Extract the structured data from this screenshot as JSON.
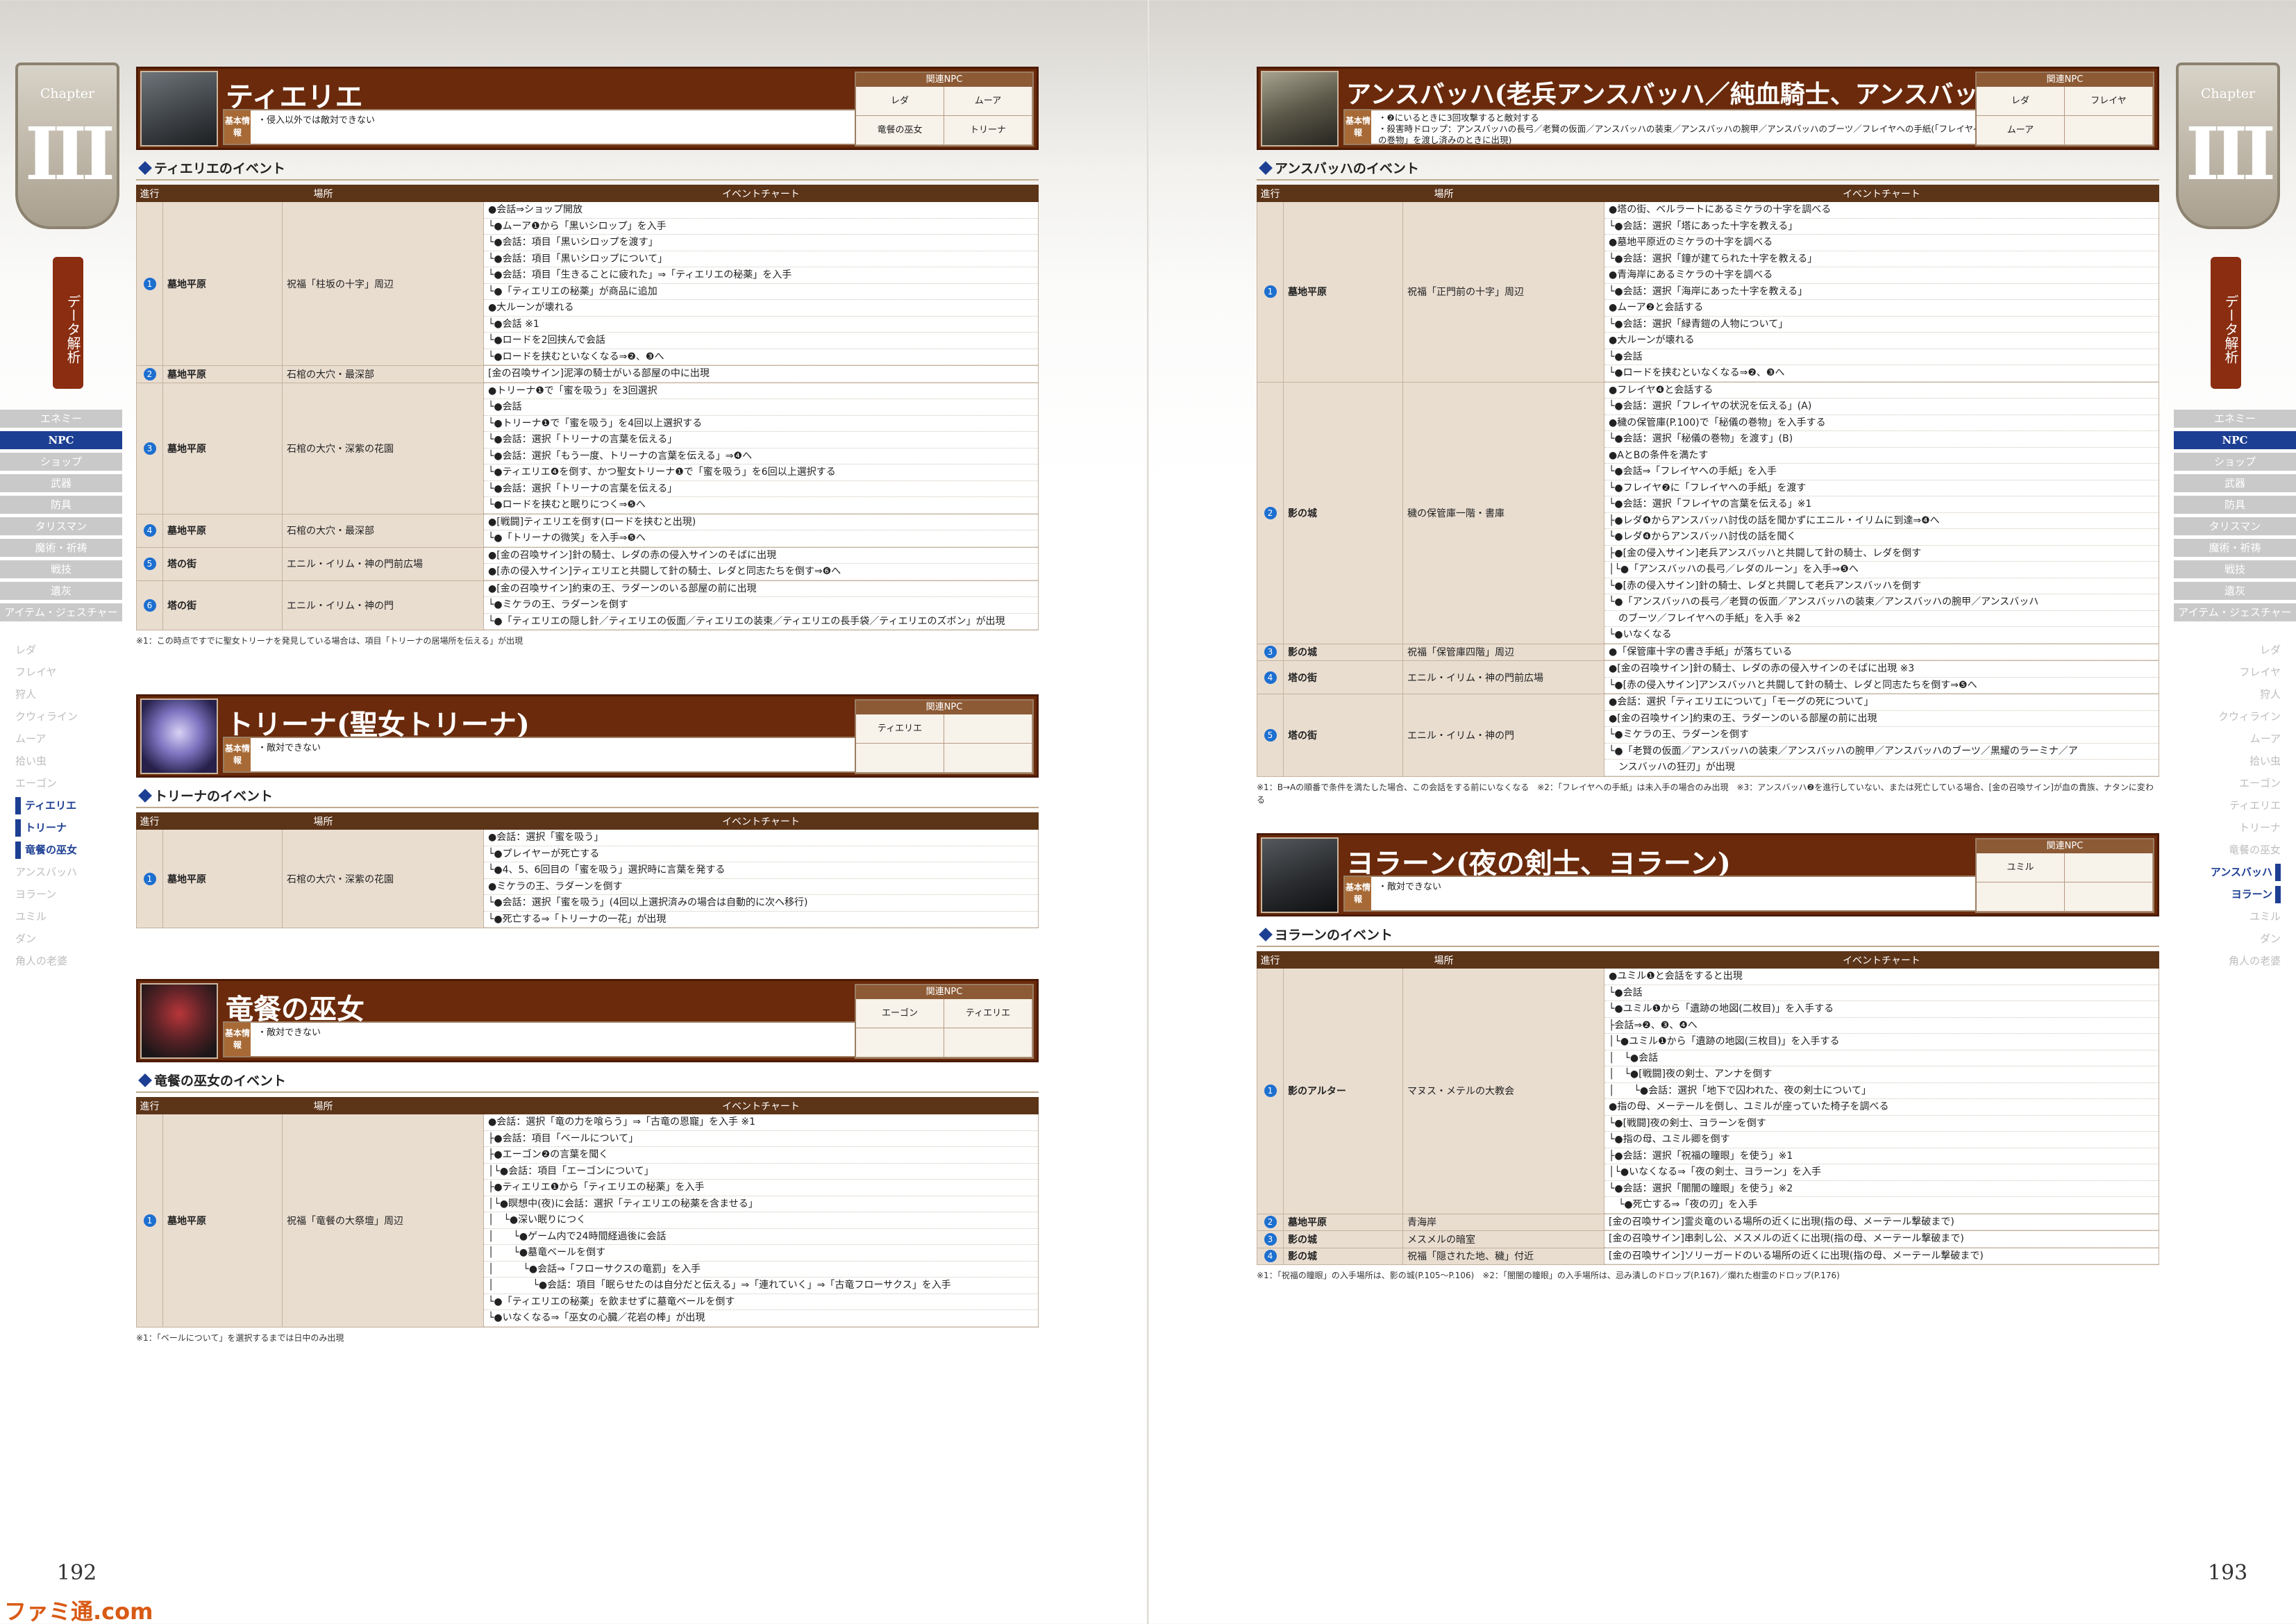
{
  "page": {
    "left_number": "192",
    "right_number": "193",
    "watermark": "ファミ通.com"
  },
  "sidebar": {
    "chapter_word": "Chapter",
    "chapter_numeral": "III",
    "vertical_tab": "データ解析",
    "categories": [
      {
        "label": "エネミー",
        "active": false
      },
      {
        "label": "NPC",
        "active": true
      },
      {
        "label": "ショップ",
        "active": false
      },
      {
        "label": "武器",
        "active": false
      },
      {
        "label": "防具",
        "active": false
      },
      {
        "label": "タリスマン",
        "active": false
      },
      {
        "label": "魔術・祈祷",
        "active": false
      },
      {
        "label": "戦技",
        "active": false
      },
      {
        "label": "遺灰",
        "active": false
      },
      {
        "label": "アイテム・ジェスチャー",
        "active": false
      }
    ],
    "npcs": [
      {
        "label": "レダ"
      },
      {
        "label": "フレイヤ"
      },
      {
        "label": "狩人"
      },
      {
        "label": "クウィライン"
      },
      {
        "label": "ムーア"
      },
      {
        "label": "拾い虫"
      },
      {
        "label": "エーゴン"
      },
      {
        "label": "ティエリエ"
      },
      {
        "label": "トリーナ"
      },
      {
        "label": "竜餐の巫女"
      },
      {
        "label": "アンスバッハ"
      },
      {
        "label": "ヨラーン"
      },
      {
        "label": "ユミル"
      },
      {
        "label": "ダン"
      },
      {
        "label": "角人の老婆"
      }
    ],
    "left_active": [
      "ティエリエ",
      "トリーナ",
      "竜餐の巫女"
    ],
    "right_active": [
      "アンスバッハ",
      "ヨラーン"
    ]
  },
  "table_headers": {
    "progress": "進行",
    "location": "場所",
    "chart": "イベントチャート"
  },
  "basic_label": "基本情報",
  "related_label": "関連NPC",
  "sections": {
    "tierie": {
      "name": "ティエリエ",
      "basic_info": "・侵入以外では敵対できない",
      "related": [
        "レダ",
        "ムーア",
        "竜餐の巫女",
        "トリーナ"
      ],
      "events_title": "ティエリエのイベント",
      "rows": [
        {
          "step": "1",
          "area": "墓地平原",
          "place": "祝福「柱坂の十字」周辺",
          "lines": [
            "●会話⇒ショップ開放",
            "└●ムーア❶から「黒いシロップ」を入手",
            "└●会話：項目「黒いシロップを渡す」",
            "└●会話：項目「黒いシロップについて」",
            "└●会話：項目「生きることに疲れた」⇒「ティエリエの秘薬」を入手",
            "└●「ティエリエの秘薬」が商品に追加",
            "●大ルーンが壊れる",
            "└●会話 ※1",
            "└●ロードを2回挟んで会話",
            "└●ロードを挟むといなくなる⇒❷、❸へ"
          ]
        },
        {
          "step": "2",
          "area": "墓地平原",
          "place": "石棺の大穴・最深部",
          "lines": [
            "[金の召喚サイン]泥濘の騎士がいる部屋の中に出現"
          ]
        },
        {
          "step": "3",
          "area": "墓地平原",
          "place": "石棺の大穴・深紫の花園",
          "lines": [
            "●トリーナ❶で「蜜を吸う」を3回選択",
            "└●会話",
            "└●トリーナ❶で「蜜を吸う」を4回以上選択する",
            "└●会話：選択「トリーナの言葉を伝える」",
            "└●会話：選択「もう一度、トリーナの言葉を伝える」⇒❹へ",
            "└●ティエリエ❹を倒す、かつ聖女トリーナ❶で「蜜を吸う」を6回以上選択する",
            "└●会話：選択「トリーナの言葉を伝える」",
            "└●ロードを挟むと眠りにつく⇒❺へ"
          ]
        },
        {
          "step": "4",
          "area": "墓地平原",
          "place": "石棺の大穴・最深部",
          "lines": [
            "●[戦闘]ティエリエを倒す(ロードを挟むと出現)",
            "└●「トリーナの微笑」を入手⇒❺へ"
          ]
        },
        {
          "step": "5",
          "area": "塔の街",
          "place": "エニル・イリム・神の門前広場",
          "lines": [
            "●[金の召喚サイン]針の騎士、レダの赤の侵入サインのそばに出現",
            "●[赤の侵入サイン]ティエリエと共闘して針の騎士、レダと同志たちを倒す⇒❻へ"
          ]
        },
        {
          "step": "6",
          "area": "塔の街",
          "place": "エニル・イリム・神の門",
          "lines": [
            "●[金の召喚サイン]約束の王、ラダーンのいる部屋の前に出現",
            "└●ミケラの王、ラダーンを倒す",
            "└●「ティエリエの隠し針／ティエリエの仮面／ティエリエの装束／ティエリエの長手袋／ティエリエのズボン」が出現"
          ]
        }
      ],
      "note": "※1：この時点ですでに聖女トリーナを発見している場合は、項目「トリーナの居場所を伝える」が出現"
    },
    "trina": {
      "name": "トリーナ(聖女トリーナ)",
      "basic_info": "・敵対できない",
      "related": [
        "ティエリエ",
        "",
        "",
        ""
      ],
      "events_title": "トリーナのイベント",
      "rows": [
        {
          "step": "1",
          "area": "墓地平原",
          "place": "石棺の大穴・深紫の花園",
          "lines": [
            "●会話：選択「蜜を吸う」",
            "└●プレイヤーが死亡する",
            "└●4、5、6回目の「蜜を吸う」選択時に言葉を発する",
            "●ミケラの王、ラダーンを倒す",
            "└●会話：選択「蜜を吸う」(4回以上選択済みの場合は自動的に次へ移行)",
            "└●死亡する⇒「トリーナの一花」が出現"
          ]
        }
      ]
    },
    "dragon": {
      "name": "竜餐の巫女",
      "basic_info": "・敵対できない",
      "related": [
        "エーゴン",
        "ティエリエ",
        "",
        ""
      ],
      "events_title": "竜餐の巫女のイベント",
      "rows": [
        {
          "step": "1",
          "area": "墓地平原",
          "place": "祝福「竜餐の大祭壇」周辺",
          "lines": [
            "●会話：選択「竜の力を喰らう」⇒「古竜の恩寵」を入手 ※1",
            "├●会話：項目「ベールについて」",
            "├●エーゴン❷の言葉を聞く",
            "│└●会話：項目「エーゴンについて」",
            "├●ティエリエ❶から「ティエリエの秘薬」を入手",
            "│└●瞑想中(夜)に会話：選択「ティエリエの秘薬を含ませる」",
            "│　└●深い眠りにつく",
            "│　　└●ゲーム内で24時間経過後に会話",
            "│　　└●墓竜ベールを倒す",
            "│　　　└●会話⇒「フローサクスの竜罰」を入手",
            "│　　　　└●会話：項目「眠らせたのは自分だと伝える」⇒「連れていく」⇒「古竜フローサクス」を入手",
            "└●「ティエリエの秘薬」を飲ませずに墓竜ベールを倒す",
            "└●いなくなる⇒「巫女の心臓／花岩の棒」が出現"
          ]
        }
      ],
      "note": "※1：「ベールについて」を選択するまでは日中のみ出現"
    },
    "ansbach": {
      "name": "アンスバッハ(老兵アンスバッハ／純血騎士、アンスバッハ)",
      "basic_info_lines": [
        "・❷にいるときに3回攻撃すると敵対する",
        "・殺害時ドロップ：アンスバッハの長弓／老賢の仮面／アンスバッハの装束／アンスバッハの腕甲／アンスバッハのブーツ／フレイヤへの手紙(「フレイヤへの手紙」は「秘蔵の巻物」を渡し済みのときに出現)"
      ],
      "related": [
        "レダ",
        "フレイヤ",
        "ムーア",
        ""
      ],
      "events_title": "アンスバッハのイベント",
      "rows": [
        {
          "step": "1",
          "area": "墓地平原",
          "place": "祝福「正門前の十字」周辺",
          "lines": [
            "●塔の街、ベルラートにあるミケラの十字を調べる",
            "└●会話：選択「塔にあった十字を教える」",
            "●墓地平原近のミケラの十字を調べる",
            "└●会話：選択「鐘が建てられた十字を教える」",
            "●青海岸にあるミケラの十字を調べる",
            "└●会話：選択「海岸にあった十字を教える」",
            "●ムーア❷と会話する",
            "└●会話：選択「緑青鎧の人物について」",
            "●大ルーンが壊れる",
            "└●会話",
            "└●ロードを挟むといなくなる⇒❷、❸へ"
          ]
        },
        {
          "step": "2",
          "area": "影の城",
          "place": "穢の保管庫一階・書庫",
          "lines": [
            "●フレイヤ❹と会話する",
            "└●会話：選択「フレイヤの状況を伝える」(A)",
            "●穢の保管庫(P.100)で「秘儀の巻物」を入手する",
            "└●会話：選択「秘儀の巻物」を渡す」(B)",
            "●AとBの条件を満たす",
            "└●会話⇒「フレイヤへの手紙」を入手",
            "└●フレイヤ❷に「フレイヤへの手紙」を渡す",
            "└●会話：選択「フレイヤの言葉を伝える」※1",
            "├●レダ❹からアンスバッハ討伐の話を聞かずにエニル・イリムに到達⇒❹へ",
            "└●レダ❹からアンスバッハ討伐の話を聞く",
            "├●[金の侵入サイン]老兵アンスバッハと共闘して針の騎士、レダを倒す",
            "│└●「アンスバッハの長弓／レダのルーン」を入手⇒❺へ",
            "└●[赤の侵入サイン]針の騎士、レダと共闘して老兵アンスバッハを倒す",
            "└●「アンスバッハの長弓／老賢の仮面／アンスバッハの装束／アンスバッハの腕甲／アンスバッハ",
            "　のブーツ／フレイヤへの手紙」を入手 ※2",
            "└●いなくなる"
          ]
        },
        {
          "step": "3",
          "area": "影の城",
          "place": "祝福「保管庫四階」周辺",
          "lines": [
            "●「保管庫十字の書き手紙」が落ちている"
          ]
        },
        {
          "step": "4",
          "area": "塔の街",
          "place": "エニル・イリム・神の門前広場",
          "lines": [
            "●[金の召喚サイン]針の騎士、レダの赤の侵入サインのそばに出現 ※3",
            "└●[赤の侵入サイン]アンスバッハと共闘して針の騎士、レダと同志たちを倒す⇒❺へ"
          ]
        },
        {
          "step": "5",
          "area": "塔の街",
          "place": "エニル・イリム・神の門",
          "lines": [
            "●会話：選択「ティエリエについて」「モーグの死について」",
            "●[金の召喚サイン]約束の王、ラダーンのいる部屋の前に出現",
            "└●ミケラの王、ラダーンを倒す",
            "└●「老賢の仮面／アンスバッハの装束／アンスバッハの腕甲／アンスバッハのブーツ／黒耀のラーミナ／ア",
            "　ンスバッハの狂刃」が出現"
          ]
        }
      ],
      "note": "※1：B→Aの順番で条件を満たした場合、この会話をする前にいなくなる　※2：「フレイヤへの手紙」は未入手の場合のみ出現　※3：アンスバッハ❷を進行していない、または死亡している場合、[金の召喚サイン]が血の貴族、ナタンに変わる"
    },
    "yoran": {
      "name": "ヨラーン(夜の剣士、ヨラーン)",
      "basic_info": "・敵対できない",
      "related": [
        "ユミル",
        "",
        "",
        ""
      ],
      "events_title": "ヨラーンのイベント",
      "rows": [
        {
          "step": "1",
          "area": "影のアルター",
          "place": "マヌス・メテルの大教会",
          "lines": [
            "●ユミル❶と会話をすると出現",
            "└●会話",
            "└●ユミル❶から「遺跡の地図(二枚目)」を入手する",
            "├会話⇒❷、❸、❹へ",
            "│└●ユミル❶から「遺跡の地図(三枚目)」を入手する",
            "│　└●会話",
            "│　└●[戦闘]夜の剣士、アンナを倒す",
            "│　　└●会話：選択「地下で囚われた、夜の剣士について」",
            "●指の母、メーテールを倒し、ユミルが座っていた椅子を調べる",
            "└●[戦闘]夜の剣士、ヨラーンを倒す",
            "└●指の母、ユミル卿を倒す",
            "├●会話：選択「祝福の瞳眼」を使う」※1",
            "│└●いなくなる⇒「夜の剣士、ヨラーン」を入手",
            "└●会話：選択「闇闇の瞳眼」を使う」※2",
            "　└●死亡する⇒「夜の刃」を入手"
          ]
        },
        {
          "step": "2",
          "area": "墓地平原",
          "place": "青海岸",
          "lines": [
            "[金の召喚サイン]霊炎竜のいる場所の近くに出現(指の母、メーテール撃破まで)"
          ]
        },
        {
          "step": "3",
          "area": "影の城",
          "place": "メスメルの暗室",
          "lines": [
            "[金の召喚サイン]串刺し公、メスメルの近くに出現(指の母、メーテール撃破まで)"
          ]
        },
        {
          "step": "4",
          "area": "影の城",
          "place": "祝福「隠された地、穢」付近",
          "lines": [
            "[金の召喚サイン]ソリーガードのいる場所の近くに出現(指の母、メーテール撃破まで)"
          ]
        }
      ],
      "note": "※1：「祝福の瞳眼」の入手場所は、影の城(P.105〜P.106)　※2：「闇闇の瞳眼」の入手場所は、忌み潰しのドロップ(P.167)／爛れた樹霊のドロップ(P.176)"
    }
  }
}
